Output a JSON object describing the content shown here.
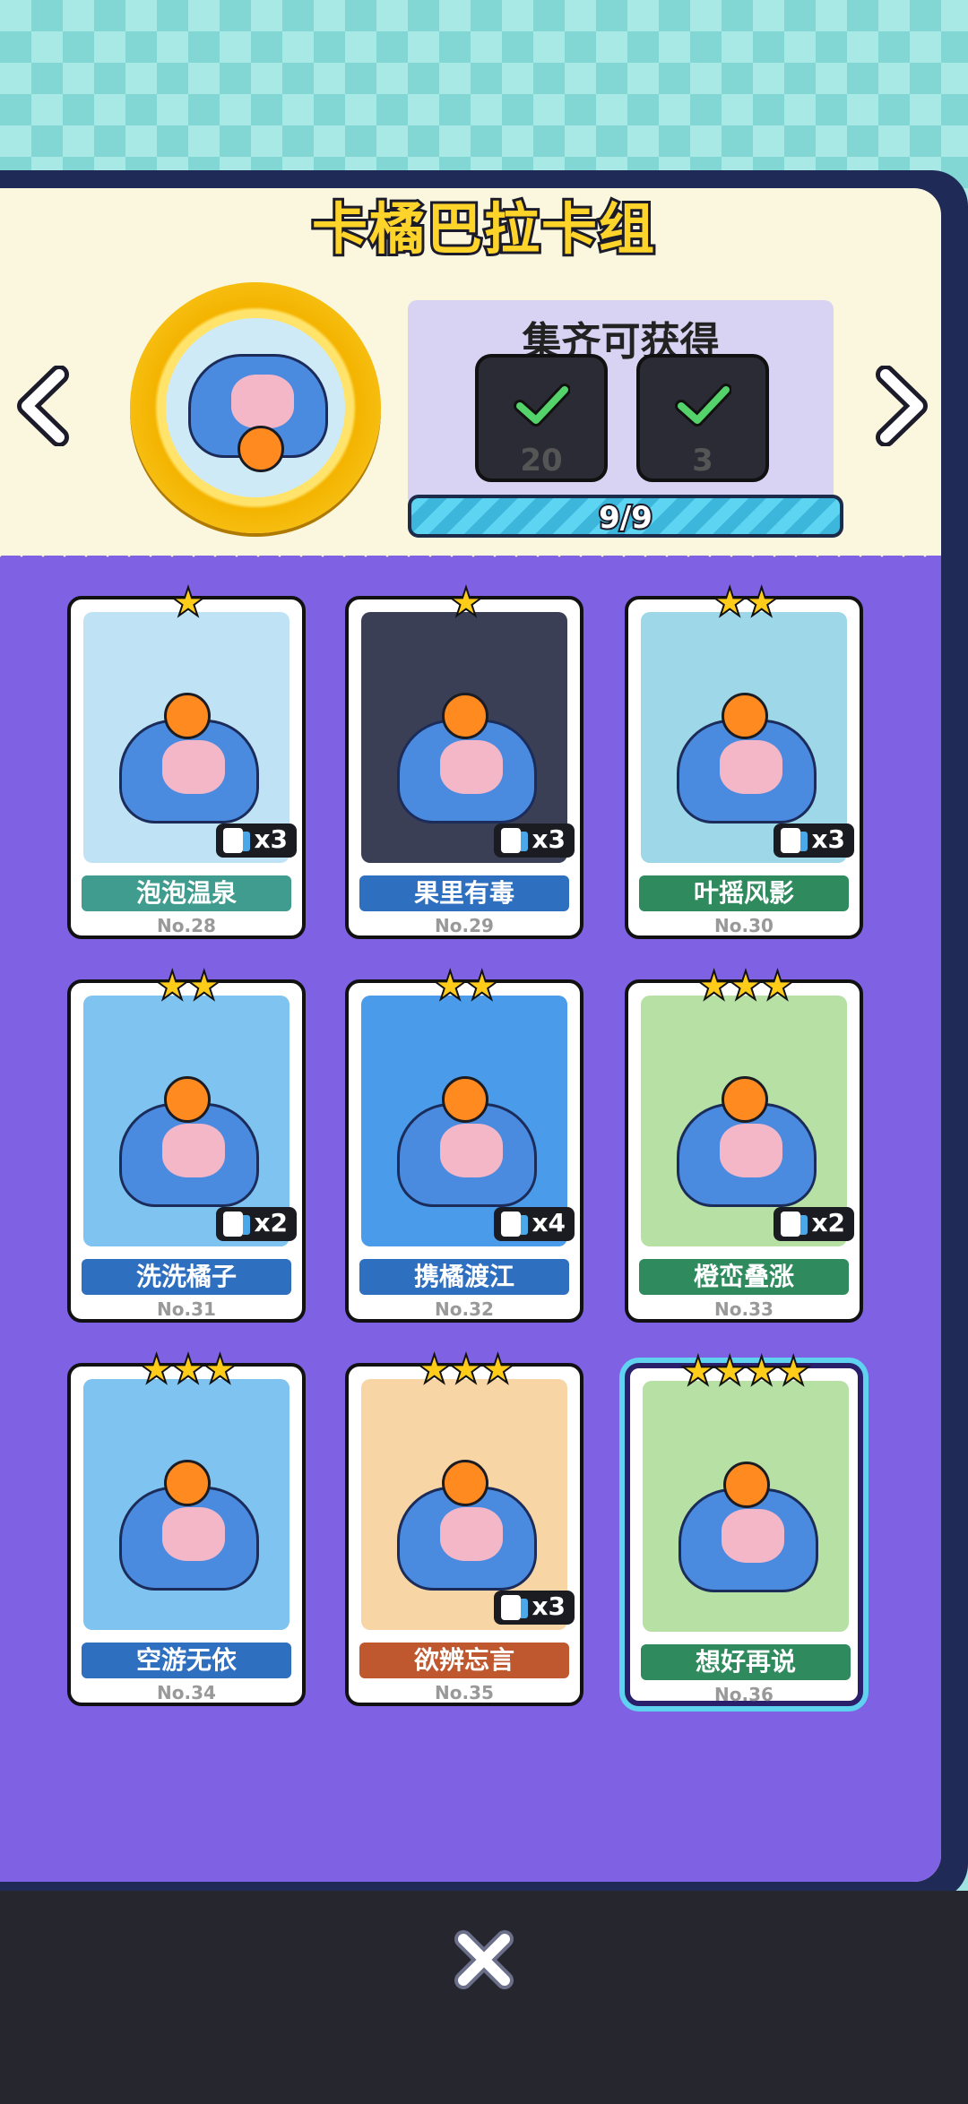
{
  "header": {
    "title": "卡橘巴拉卡组"
  },
  "reward": {
    "title": "集齐可获得",
    "items": [
      {
        "icon": "pot-icon",
        "amount": "20"
      },
      {
        "icon": "card-pack-icon",
        "amount": "3"
      }
    ],
    "progress_text": "9/9",
    "progress": 1.0
  },
  "cards": [
    {
      "name": "泡泡温泉",
      "no": "No.28",
      "stars": "★",
      "count": "x3",
      "ribbon": "#3f9c8e",
      "bg": "#bfe3f4"
    },
    {
      "name": "果里有毒",
      "no": "No.29",
      "stars": "★",
      "count": "x3",
      "ribbon": "#2f6fc0",
      "bg": "#3b3f55"
    },
    {
      "name": "叶摇风影",
      "no": "No.30",
      "stars": "★★",
      "count": "x3",
      "ribbon": "#2f8a5e",
      "bg": "#9ed7e8"
    },
    {
      "name": "洗洗橘子",
      "no": "No.31",
      "stars": "★★",
      "count": "x2",
      "ribbon": "#2f6fc0",
      "bg": "#7fc3f0"
    },
    {
      "name": "携橘渡江",
      "no": "No.32",
      "stars": "★★",
      "count": "x4",
      "ribbon": "#2f6fc0",
      "bg": "#4a9bea"
    },
    {
      "name": "橙峦叠涨",
      "no": "No.33",
      "stars": "★★★",
      "count": "x2",
      "ribbon": "#2f8a5e",
      "bg": "#b6e0a4"
    },
    {
      "name": "空游无依",
      "no": "No.34",
      "stars": "★★★",
      "count": "",
      "ribbon": "#2f6fc0",
      "bg": "#7fc3f0"
    },
    {
      "name": "欲辨忘言",
      "no": "No.35",
      "stars": "★★★",
      "count": "x3",
      "ribbon": "#c0582f",
      "bg": "#f7d5a4"
    },
    {
      "name": "想好再说",
      "no": "No.36",
      "stars": "★★★★",
      "count": "",
      "ribbon": "#2f8a5e",
      "bg": "#b6e0a4"
    }
  ],
  "icons": {
    "left": "chevron-left-icon",
    "right": "chevron-right-icon",
    "close": "close-icon"
  }
}
